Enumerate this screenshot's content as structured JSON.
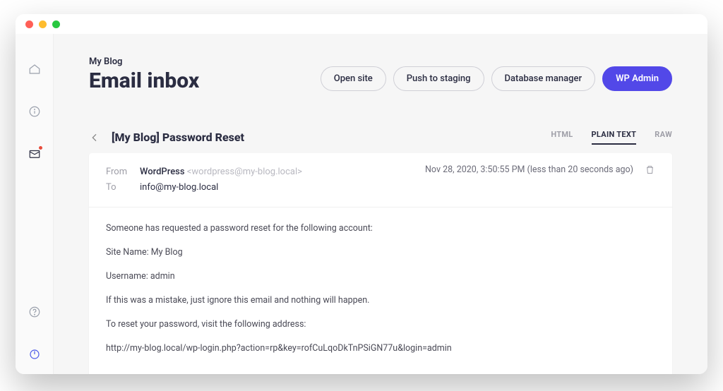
{
  "header": {
    "site_name": "My Blog",
    "page_title": "Email inbox",
    "actions": {
      "open_site": "Open site",
      "push_staging": "Push to staging",
      "db_manager": "Database manager",
      "wp_admin": "WP Admin"
    }
  },
  "email": {
    "subject": "[My Blog] Password Reset",
    "from_label": "From",
    "to_label": "To",
    "from_name": "WordPress",
    "from_addr": "<wordpress@my-blog.local>",
    "to_addr": "info@my-blog.local",
    "timestamp": "Nov 28, 2020, 3:50:55 PM (less than 20 seconds ago)",
    "tabs": {
      "html": "HTML",
      "plain": "PLAIN TEXT",
      "raw": "RAW"
    },
    "body": {
      "l1": "Someone has requested a password reset for the following account:",
      "l2": "Site Name: My Blog",
      "l3": "Username: admin",
      "l4": "If this was a mistake, just ignore this email and nothing will happen.",
      "l5": "To reset your password, visit the following address:",
      "l6": "http://my-blog.local/wp-login.php?action=rp&key=rofCuLqoDkTnPSiGN77u&login=admin"
    }
  }
}
